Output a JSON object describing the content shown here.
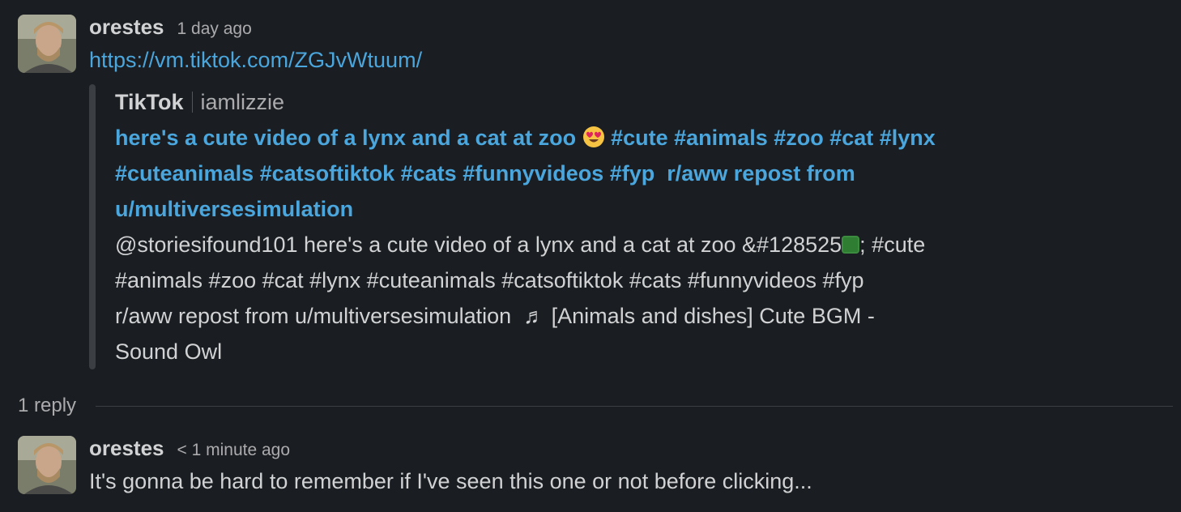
{
  "messages": [
    {
      "author": "orestes",
      "timestamp": "1 day ago",
      "link": "https://vm.tiktok.com/ZGJvWtuum/",
      "unfurl": {
        "service_name": "TikTok",
        "service_author": "iamlizzie",
        "title_part1": "here's a cute video of a lynx and a cat at zoo ",
        "title_emoji": "smiling-face-with-heart-eyes",
        "title_part2": " #cute #animals #zoo #cat #lynx\n#cuteanimals #catsoftiktok #cats #funnyvideos #fyp  r/aww repost from\nu/multiversesimulation",
        "desc_part1": "@storiesifound101 here's a cute video of a lynx and a cat at zoo &#128525",
        "desc_part2": "; #cute\n#animals #zoo #cat #lynx #cuteanimals #catsoftiktok #cats #funnyvideos #fyp\nr/aww repost from u/multiversesimulation  ♬ [Animals and dishes] Cute BGM -\nSound Owl"
      }
    },
    {
      "author": "orestes",
      "timestamp": "< 1 minute ago",
      "text": "It's gonna be hard to remember if I've seen this one or not before clicking..."
    }
  ],
  "thread": {
    "reply_count": "1 reply"
  },
  "colors": {
    "background": "#1a1d21",
    "link": "#4aa6dc",
    "text": "#d1d2d3",
    "muted": "#ababad"
  }
}
